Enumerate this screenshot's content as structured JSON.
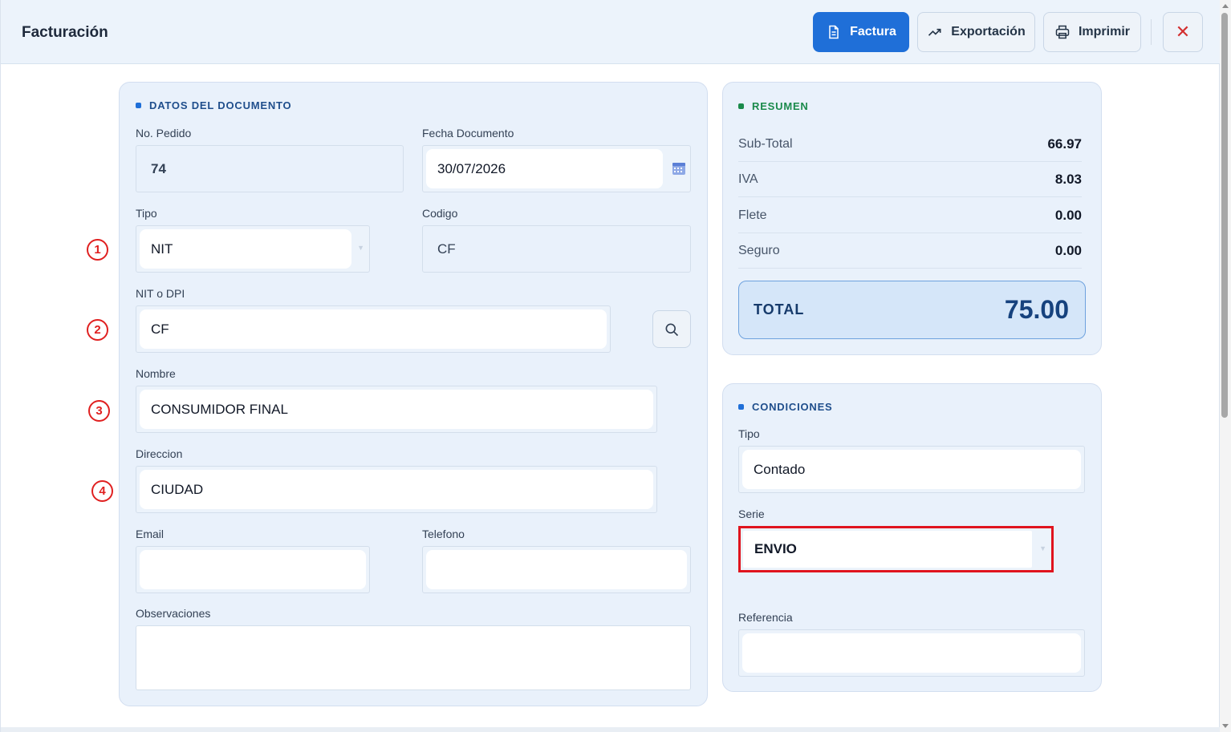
{
  "header": {
    "title": "Facturación",
    "buttons": {
      "factura": "Factura",
      "exportacion": "Exportación",
      "imprimir": "Imprimir",
      "close": "✕"
    }
  },
  "documento": {
    "section_title": "DATOS DEL DOCUMENTO",
    "no_pedido": {
      "label": "No. Pedido",
      "value": "74"
    },
    "fecha": {
      "label": "Fecha Documento",
      "value": "30/07/2026"
    },
    "tipo": {
      "label": "Tipo",
      "value": "NIT"
    },
    "codigo": {
      "label": "Codigo",
      "value": "CF"
    },
    "nit": {
      "label": "NIT o DPI",
      "value": "CF"
    },
    "nombre": {
      "label": "Nombre",
      "value": "CONSUMIDOR FINAL"
    },
    "direccion": {
      "label": "Direccion",
      "value": "CIUDAD"
    },
    "email": {
      "label": "Email",
      "value": ""
    },
    "telefono": {
      "label": "Telefono",
      "value": ""
    },
    "observaciones": {
      "label": "Observaciones",
      "value": ""
    }
  },
  "markers": [
    "1",
    "2",
    "3",
    "4"
  ],
  "resumen": {
    "section_title": "RESUMEN",
    "rows": [
      {
        "label": "Sub-Total",
        "value": "66.97"
      },
      {
        "label": "IVA",
        "value": "8.03"
      },
      {
        "label": "Flete",
        "value": "0.00"
      },
      {
        "label": "Seguro",
        "value": "0.00"
      }
    ],
    "total_label": "TOTAL",
    "total_value": "75.00"
  },
  "condiciones": {
    "section_title": "CONDICIONES",
    "tipo": {
      "label": "Tipo",
      "value": "Contado"
    },
    "serie": {
      "label": "Serie",
      "value": "ENVIO"
    },
    "referencia": {
      "label": "Referencia",
      "value": ""
    }
  },
  "colors": {
    "accent": "#1f6fd8",
    "section_blue": "#1f4e8c",
    "section_green": "#1a8a4a",
    "annotation_red": "#e02020"
  }
}
